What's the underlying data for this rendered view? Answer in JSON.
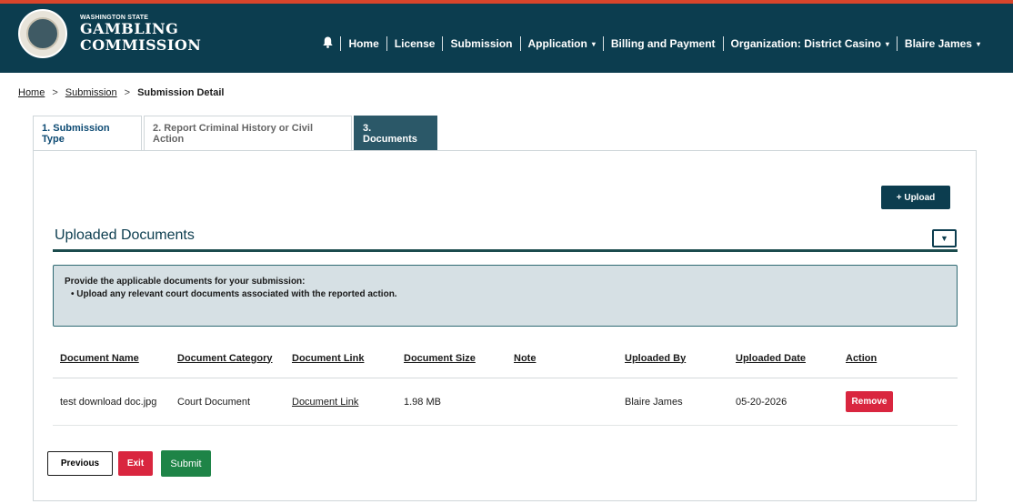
{
  "header": {
    "logo_small": "WASHINGTON STATE",
    "logo_line1": "GAMBLING",
    "logo_line2": "COMMISSION",
    "brand_color": "#0c3d4f",
    "accent_stripe": "#d9452b",
    "nav": {
      "bell_icon": "bell-icon",
      "home": "Home",
      "license": "License",
      "submission": "Submission",
      "application": "Application",
      "billing": "Billing and Payment",
      "organization": "Organization: District Casino",
      "user": "Blaire James"
    }
  },
  "breadcrumb": {
    "home": "Home",
    "submission": "Submission",
    "current": "Submission Detail",
    "separator": ">"
  },
  "tabs": [
    {
      "label": "1. Submission Type",
      "active": false
    },
    {
      "label": "2. Report Criminal History or Civil Action",
      "active": false
    },
    {
      "label": "3. Documents",
      "active": true
    }
  ],
  "documents": {
    "upload_label": "+ Upload",
    "section_title": "Uploaded Documents",
    "collapse_icon": "triangle-down-icon",
    "notice_title": "Provide the applicable documents for your submission:",
    "notice_bullet": "• Upload any relevant court documents associated with the reported action.",
    "columns": [
      "Document Name",
      "Document Category",
      "Document Link",
      "Document Size",
      "Note",
      "Uploaded By",
      "Uploaded Date",
      "Action"
    ],
    "rows": [
      {
        "name": "test download doc.jpg",
        "category": "Court Document",
        "link": "Document Link",
        "size": "1.98 MB",
        "note": "",
        "uploaded_by": "Blaire James",
        "uploaded_date": "05-20-2026",
        "action": "Remove"
      }
    ]
  },
  "footer": {
    "previous": "Previous",
    "exit": "Exit",
    "submit": "Submit"
  }
}
